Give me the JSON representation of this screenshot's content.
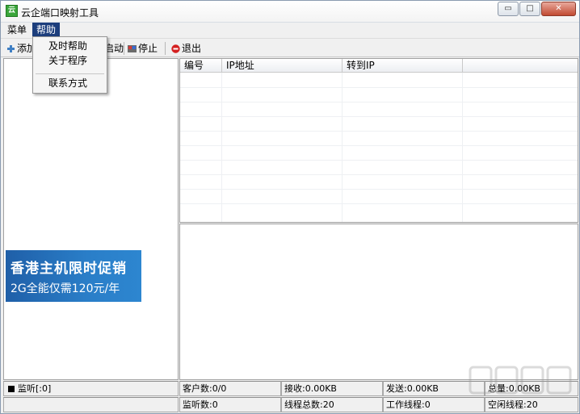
{
  "window": {
    "title": "云企端口映射工具",
    "app_icon_glyph": "云",
    "controls": {
      "minimize": "▭",
      "maximize": "□",
      "close": "✕"
    }
  },
  "menubar": {
    "items": [
      {
        "label": "菜单",
        "active": false
      },
      {
        "label": "帮助",
        "active": true
      }
    ]
  },
  "help_menu": {
    "items": [
      "及时帮助",
      "关于程序",
      "联系方式"
    ]
  },
  "toolbar": {
    "add_label": "添加",
    "start_label": "启动",
    "stop_label": "停止",
    "exit_label": "退出"
  },
  "ad": {
    "line1": "香港主机限时促销",
    "line2": "2G全能仅需120元/年"
  },
  "table": {
    "columns": [
      "编号",
      "IP地址",
      "转到IP"
    ]
  },
  "status": {
    "listen": "监听[:0]",
    "clients": "客户数:0/0",
    "received": "接收:0.00KB",
    "sent": "发送:0.00KB",
    "total": "总量:0.00KB",
    "listen_count": "监听数:0",
    "thread_total": "线程总数:20",
    "working_threads": "工作线程:0",
    "idle_threads": "空闲线程:20"
  },
  "colors": {
    "menu_active": "#1c3e7c",
    "ad_blue": "#2a7ec8",
    "close_red": "#c14a32"
  }
}
